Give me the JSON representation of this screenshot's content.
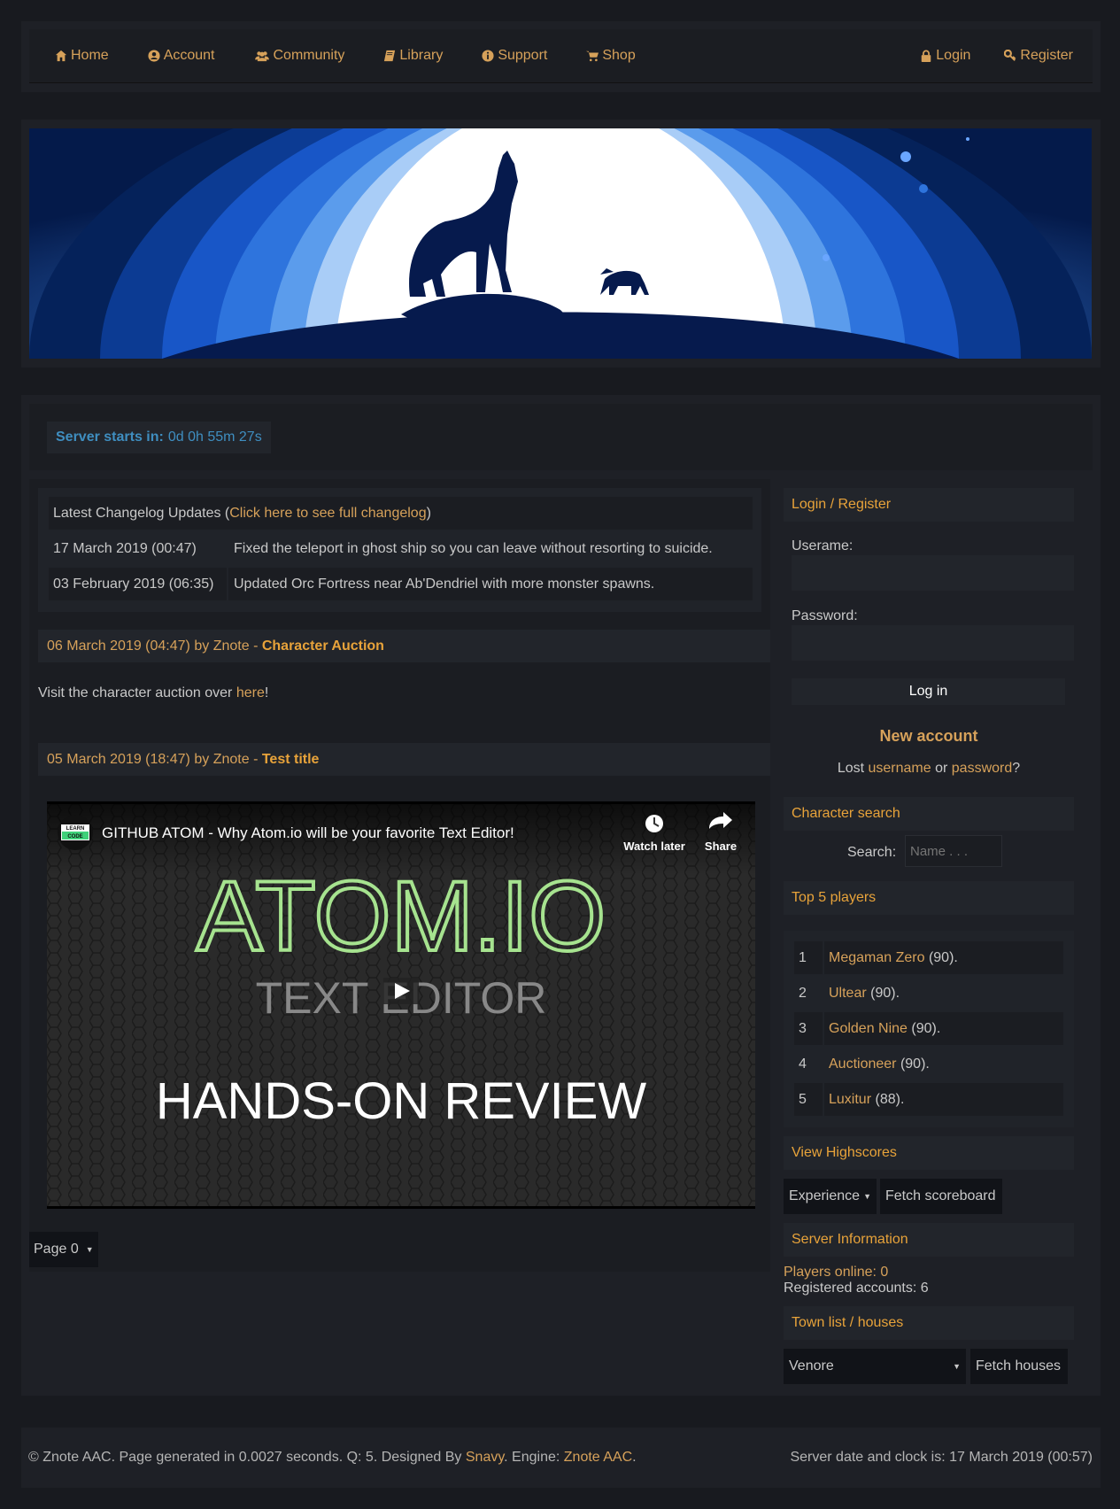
{
  "nav": {
    "left": [
      {
        "label": "Home",
        "icon": "home-icon"
      },
      {
        "label": "Account",
        "icon": "user-circle-icon"
      },
      {
        "label": "Community",
        "icon": "users-icon"
      },
      {
        "label": "Library",
        "icon": "book-icon"
      },
      {
        "label": "Support",
        "icon": "info-icon"
      },
      {
        "label": "Shop",
        "icon": "cart-icon"
      }
    ],
    "right": [
      {
        "label": "Login",
        "icon": "lock-icon"
      },
      {
        "label": "Register",
        "icon": "key-icon"
      }
    ]
  },
  "countdown": {
    "label": "Server starts in:",
    "value": "0d 0h 55m 27s"
  },
  "changelog": {
    "heading_prefix": "Latest Changelog Updates (",
    "heading_link": "Click here to see full changelog",
    "heading_suffix": ")",
    "rows": [
      {
        "date": "17 March 2019 (00:47)",
        "text": "Fixed the teleport in ghost ship so you can leave without resorting to suicide."
      },
      {
        "date": "03 February 2019 (06:35)",
        "text": "Updated Orc Fortress near Ab'Dendriel with more monster spawns."
      }
    ]
  },
  "posts": [
    {
      "date": "06 March 2019 (04:47)",
      "by": "by",
      "author": "Znote",
      "sep": "-",
      "title": "Character Auction",
      "body_prefix": "Visit the character auction over ",
      "body_link": "here",
      "body_suffix": "!"
    },
    {
      "date": "05 March 2019 (18:47)",
      "by": "by",
      "author": "Znote",
      "sep": "-",
      "title": "Test title"
    }
  ],
  "video": {
    "channel_badge_line1": "LEARN",
    "channel_badge_line2": "CODE",
    "title": "GITHUB ATOM - Why Atom.io will be your favorite Text Editor!",
    "watch_later": "Watch later",
    "share": "Share",
    "big_title": "ATOM.IO",
    "subtitle": "TEXT EDITOR",
    "bottom": "HANDS-ON REVIEW"
  },
  "pagination": {
    "label": "Page 0"
  },
  "sidebar": {
    "login_title": "Login / Register",
    "username_label": "Userame:",
    "password_label": "Password:",
    "login_button": "Log in",
    "new_account": "New account",
    "lost_prefix": "Lost ",
    "lost_username": "username",
    "lost_or": " or ",
    "lost_password": "password",
    "lost_suffix": "?",
    "search_title": "Character search",
    "search_label": "Search:",
    "search_placeholder": "Name . . .",
    "top5_title": "Top 5 players",
    "top5": [
      {
        "rank": "1",
        "name": "Megaman Zero",
        "level": "(90)."
      },
      {
        "rank": "2",
        "name": "Ultear",
        "level": "(90)."
      },
      {
        "rank": "3",
        "name": "Golden Nine",
        "level": "(90)."
      },
      {
        "rank": "4",
        "name": "Auctioneer",
        "level": "(90)."
      },
      {
        "rank": "5",
        "name": "Luxitur",
        "level": "(88)."
      }
    ],
    "highscores_title": "View Highscores",
    "highscore_select": "Experience",
    "fetch_scoreboard": "Fetch scoreboard",
    "server_info_title": "Server Information",
    "players_online": "Players online: 0",
    "registered_accounts": "Registered accounts: 6",
    "town_title": "Town list / houses",
    "town_select": "Venore",
    "fetch_houses": "Fetch houses"
  },
  "footer": {
    "left_prefix": "© Znote AAC. Page generated in 0.0027 seconds. Q: 5. Designed By ",
    "designer": "Snavy",
    "engine_prefix": ". Engine: ",
    "engine": "Znote AAC",
    "engine_suffix": ".",
    "right": "Server date and clock is: 17 March 2019 (00:57)"
  }
}
